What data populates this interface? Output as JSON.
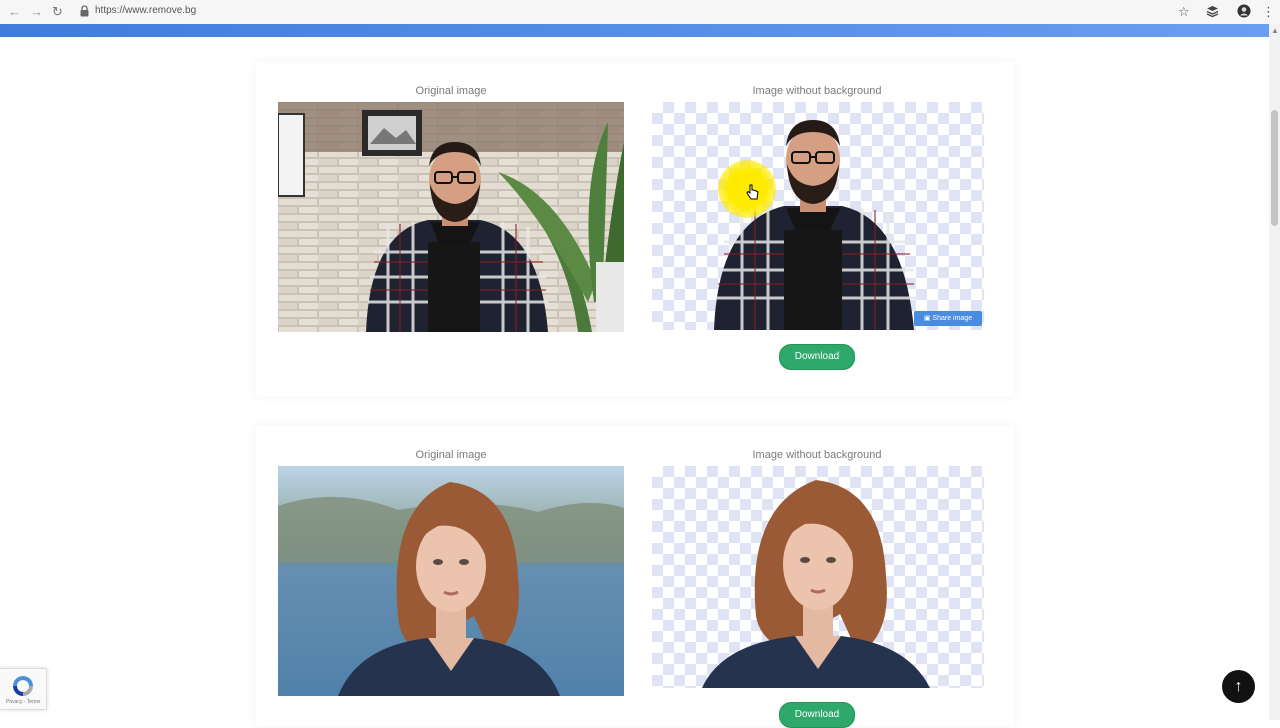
{
  "browser": {
    "url": "https://www.remove.bg",
    "icons": [
      "back-icon",
      "forward-icon",
      "reload-icon",
      "lock-icon",
      "star-icon",
      "extensions-icon",
      "profile-icon",
      "menu-icon"
    ]
  },
  "results": [
    {
      "original_label": "Original image",
      "removed_label": "Image without background",
      "share_label": "Share image",
      "download_label": "Download"
    },
    {
      "original_label": "Original image",
      "removed_label": "Image without background",
      "download_label": "Download"
    }
  ],
  "recaptcha": {
    "text": "Privacy - Terms"
  },
  "colors": {
    "accent_blue": "#3f7ddc",
    "download_green": "#2ea86b",
    "checker": "#dfe3f4"
  }
}
